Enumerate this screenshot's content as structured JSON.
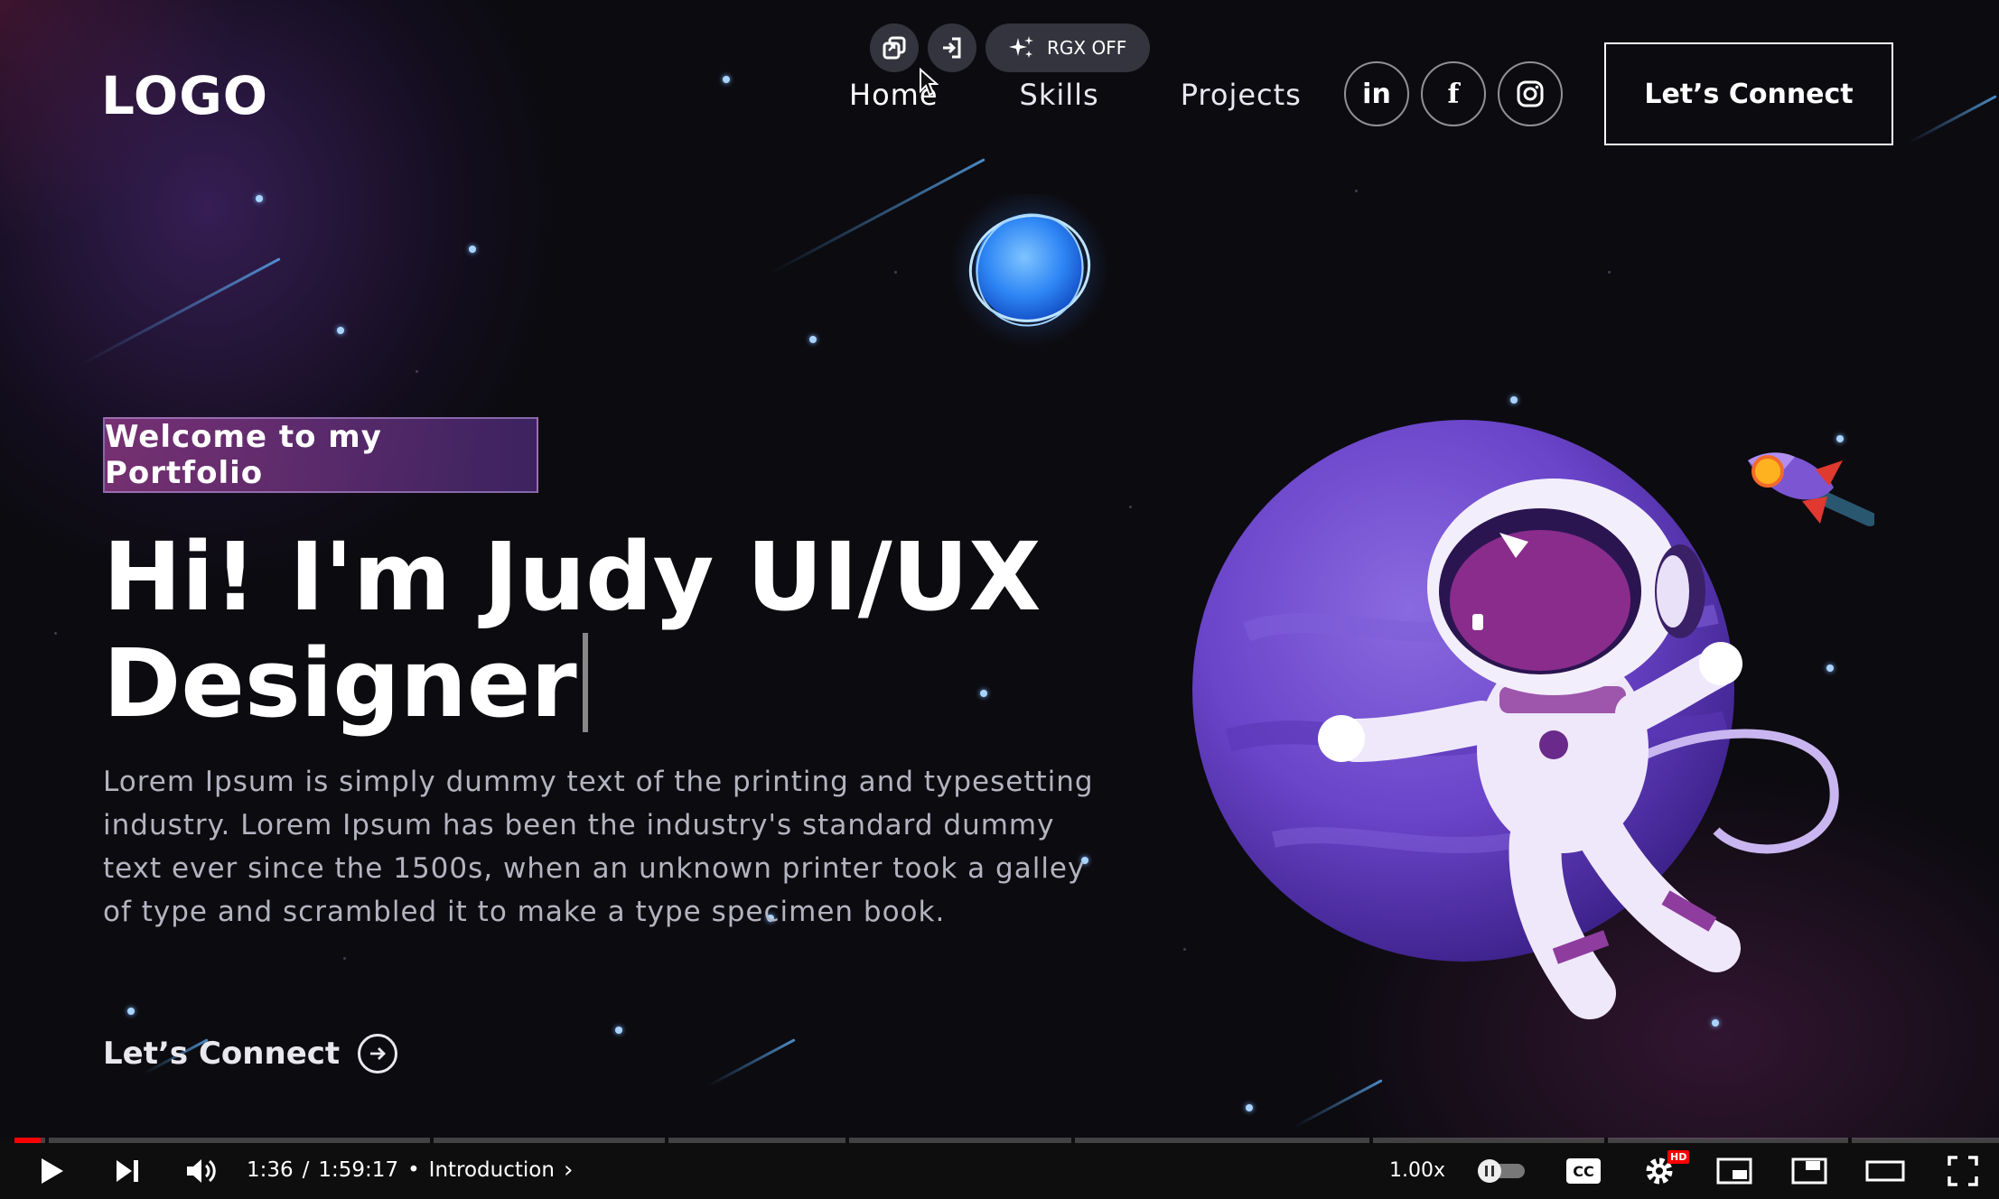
{
  "site": {
    "logo": "LOGO",
    "nav": [
      {
        "label": "Home",
        "active": true
      },
      {
        "label": "Skills",
        "active": false
      },
      {
        "label": "Projects",
        "active": false
      }
    ],
    "social": [
      {
        "icon": "linkedin-icon",
        "glyph": "in"
      },
      {
        "icon": "facebook-icon",
        "glyph": "f"
      },
      {
        "icon": "instagram-icon",
        "glyph": ""
      }
    ],
    "connect_button": "Let’s Connect"
  },
  "overlay": {
    "rgx_label": "RGX OFF"
  },
  "hero": {
    "badge": "Welcome to my Portfolio",
    "headline_line1": "Hi! I'm Judy UI/UX",
    "headline_line2": "Designer",
    "description": "Lorem Ipsum is simply dummy text of the printing and typesetting industry. Lorem Ipsum has been the industry's standard dummy text ever since the 1500s, when an unknown printer took a galley of type and scrambled it to make a type specimen book.",
    "cta": "Let’s Connect"
  },
  "player": {
    "progress": 0.013,
    "time_current": "1:36",
    "time_separator": "/",
    "time_total": "1:59:17",
    "chapter": "Introduction",
    "speed": "1.00x",
    "cc_label": "CC",
    "hd_badge": "HD"
  },
  "colors": {
    "progress_red": "#ff0000",
    "badge_gradient_start": "#963c8c",
    "badge_gradient_end": "#502d82",
    "planet_purple": "#6a44c9"
  }
}
